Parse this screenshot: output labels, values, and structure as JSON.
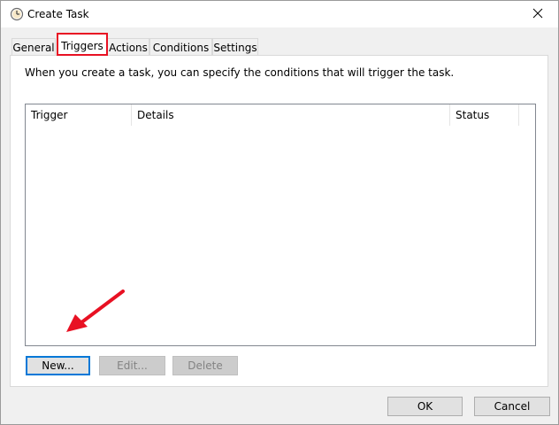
{
  "window": {
    "title": "Create Task"
  },
  "tabs": [
    {
      "label": "General"
    },
    {
      "label": "Triggers"
    },
    {
      "label": "Actions"
    },
    {
      "label": "Conditions"
    },
    {
      "label": "Settings"
    }
  ],
  "active_tab": "Triggers",
  "triggers_panel": {
    "description": "When you create a task, you can specify the conditions that will trigger the task.",
    "columns": [
      "Trigger",
      "Details",
      "Status"
    ],
    "rows": []
  },
  "buttons": {
    "new_label": "New...",
    "edit_label": "Edit...",
    "delete_label": "Delete",
    "ok_label": "OK",
    "cancel_label": "Cancel"
  },
  "icons": {
    "title": "clock-icon",
    "close": "close-icon",
    "annotation": "red-arrow-icon"
  },
  "colors": {
    "highlight": "#e81123",
    "focus": "#0078d7"
  }
}
